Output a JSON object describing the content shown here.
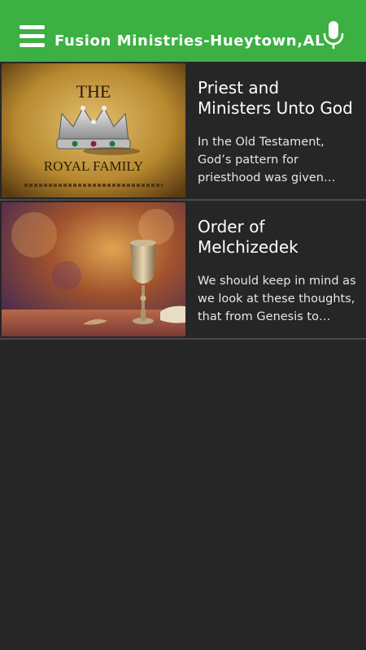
{
  "app_bar": {
    "title": "Fusion Ministries-Hueytown,AL",
    "menu_icon": "hamburger-menu-icon",
    "mic_icon": "microphone-icon",
    "color": "#3cb043"
  },
  "theme": {
    "background": "#262626",
    "divider": "#4a4a4a"
  },
  "articles": [
    {
      "title": "Priest and Ministers Unto God",
      "excerpt": "In the Old Testament, God’s pattern for priesthood was given through the Levites",
      "image": {
        "caption_top": "THE",
        "caption_bottom": "ROYAL FAMILY"
      }
    },
    {
      "title": "Order of Melchizedek",
      "excerpt": "We should keep in mind as we look at these thoughts, that from Genesis to Revelation"
    }
  ]
}
